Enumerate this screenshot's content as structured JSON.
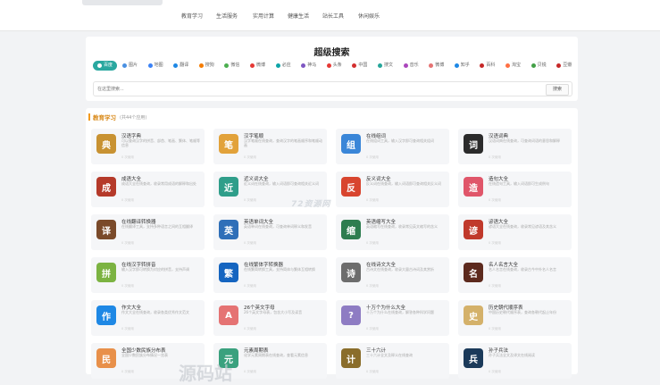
{
  "nav": {
    "items": [
      "教育学习",
      "生活服务",
      "实用计算",
      "健康生活",
      "站长工具",
      "休闲娱乐"
    ]
  },
  "search": {
    "title": "超级搜索",
    "placeholder": "在这里搜索...",
    "button": "搜索",
    "engines": [
      {
        "label": "百度",
        "color": "#2aa8a0"
      },
      {
        "label": "图片",
        "color": "#4a90e2"
      },
      {
        "label": "地图",
        "color": "#3b82f6"
      },
      {
        "label": "翻译",
        "color": "#1e88e5"
      },
      {
        "label": "搜狗",
        "color": "#f57c00"
      },
      {
        "label": "微信",
        "color": "#4caf50"
      },
      {
        "label": "微博",
        "color": "#e53935"
      },
      {
        "label": "必应",
        "color": "#0ea5a8"
      },
      {
        "label": "神马",
        "color": "#7e57c2"
      },
      {
        "label": "头条",
        "color": "#e53935"
      },
      {
        "label": "中国",
        "color": "#d32f2f"
      },
      {
        "label": "搜文",
        "color": "#26a69a"
      },
      {
        "label": "音乐",
        "color": "#ab47bc"
      },
      {
        "label": "微博",
        "color": "#e57373"
      },
      {
        "label": "知乎",
        "color": "#1e88e5"
      },
      {
        "label": "百科",
        "color": "#c62828"
      },
      {
        "label": "淘宝",
        "color": "#ff7043"
      },
      {
        "label": "贝锐",
        "color": "#43a047"
      },
      {
        "label": "豆瓣",
        "color": "#c62828"
      }
    ]
  },
  "section": {
    "title": "教育学习",
    "count": "(共44个应用)"
  },
  "tools": [
    {
      "name": "汉语字典",
      "icon": "典",
      "color": "#c89232",
      "desc": "可以查询汉字的拼音、部首、笔画、繁体、笔顺等信息",
      "meta": "0 次使用"
    },
    {
      "name": "汉字笔顺",
      "icon": "笔",
      "color": "#e2a23a",
      "desc": "汉字笔顺在线查询，查询汉字的笔画顺序和笔顺动画",
      "meta": "0 次使用"
    },
    {
      "name": "在线组词",
      "icon": "组",
      "color": "#3a86d8",
      "desc": "在线组词工具，输入汉字即可查询相关组词",
      "meta": "0 次使用"
    },
    {
      "name": "汉语词典",
      "icon": "词",
      "color": "#2b2b2b",
      "desc": "汉语词典在线查询，可查询词语的意思和解释",
      "meta": "0 次使用"
    },
    {
      "name": "成语大全",
      "icon": "成",
      "color": "#b53a2a",
      "desc": "成语大全在线查询，收录常用成语的解释和出处",
      "meta": "0 次使用"
    },
    {
      "name": "近义词大全",
      "icon": "近",
      "color": "#2f9e8a",
      "desc": "近义词在线查询，输入词语即可查询相关近义词",
      "meta": "0 次使用"
    },
    {
      "name": "反义词大全",
      "icon": "反",
      "color": "#d8452f",
      "desc": "反义词在线查询，输入词语即可查询相关反义词",
      "meta": "0 次使用"
    },
    {
      "name": "造句大全",
      "icon": "造",
      "color": "#e0566a",
      "desc": "在线造句工具，输入词语即可生成例句",
      "meta": "0 次使用"
    },
    {
      "name": "在线翻译转换器",
      "icon": "译",
      "color": "#7a4a2a",
      "desc": "在线翻译工具，支持多种语言之间的互相翻译",
      "meta": "0 次使用"
    },
    {
      "name": "英语单词大全",
      "icon": "英",
      "color": "#2f6fb8",
      "desc": "英语单词在线查询，可查询单词释义和发音",
      "meta": "0 次使用"
    },
    {
      "name": "英语缩写大全",
      "icon": "缩",
      "color": "#2e7d4f",
      "desc": "英语缩写在线查询，收录常见英文缩写的含义",
      "meta": "0 次使用"
    },
    {
      "name": "谚语大全",
      "icon": "谚",
      "color": "#c0392b",
      "desc": "谚语大全在线查询，收录常见谚语及其含义",
      "meta": "0 次使用"
    },
    {
      "name": "在线汉字转拼音",
      "icon": "拼",
      "color": "#7cb342",
      "desc": "输入汉字即可转换为对应的拼音，支持声调",
      "meta": "0 次使用"
    },
    {
      "name": "在线繁体字转换器",
      "icon": "繁",
      "color": "#1565c0",
      "desc": "在线繁简转换工具，支持简体与繁体互相转换",
      "meta": "0 次使用"
    },
    {
      "name": "在线诗文大全",
      "icon": "诗",
      "color": "#6d6d6d",
      "desc": "古诗文在线查询，收录大量古诗词及其赏析",
      "meta": "0 次使用"
    },
    {
      "name": "名人名言大全",
      "icon": "名",
      "color": "#5d2a1e",
      "desc": "名人名言在线查询，收录古今中外名人名言",
      "meta": "0 次使用"
    },
    {
      "name": "作文大全",
      "icon": "作",
      "color": "#1e88e5",
      "desc": "作文大全在线查询，收录各类优秀作文范文",
      "meta": "0 次使用"
    },
    {
      "name": "26个英文字母",
      "icon": "A",
      "color": "#e57373",
      "desc": "26个英文字母表，包含大小写及读音",
      "meta": "0 次使用"
    },
    {
      "name": "十万个为什么大全",
      "icon": "?",
      "color": "#8e7cc3",
      "desc": "十万个为什么在线查询，解答各种科学问题",
      "meta": "0 次使用"
    },
    {
      "name": "历史朝代顺序表",
      "icon": "史",
      "color": "#d4b16a",
      "desc": "中国历史朝代顺序表，查询各朝代起止年份",
      "meta": "0 次使用"
    },
    {
      "name": "全国少数民族分布表",
      "icon": "民",
      "color": "#e8904a",
      "desc": "全国少数民族分布情况一览表",
      "meta": "0 次使用"
    },
    {
      "name": "元素周期表",
      "icon": "元",
      "color": "#3aa17e",
      "desc": "化学元素周期表在线查询，查看元素信息",
      "meta": "0 次使用"
    },
    {
      "name": "三十六计",
      "icon": "计",
      "color": "#8a6d2b",
      "desc": "三十六计全文及释义在线查询",
      "meta": "0 次使用"
    },
    {
      "name": "孙子兵法",
      "icon": "兵",
      "color": "#1b3a5a",
      "desc": "孙子兵法全文及译文在线阅读",
      "meta": "0 次使用"
    }
  ],
  "watermark": "72资源网",
  "watermark2": "源码站"
}
